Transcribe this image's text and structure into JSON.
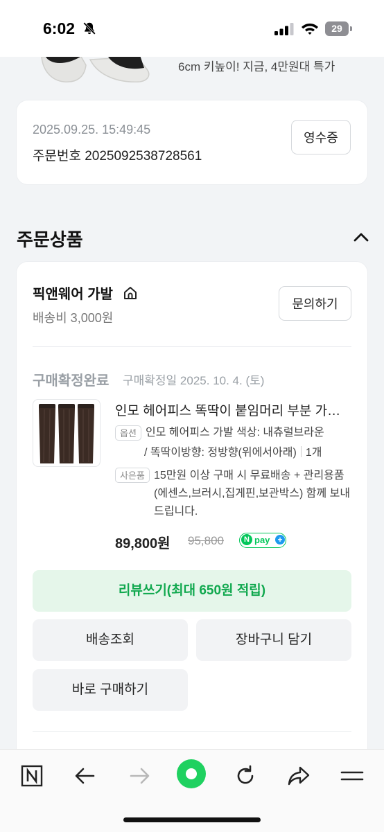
{
  "status_bar": {
    "time": "6:02",
    "battery": "29",
    "icons": [
      "bell-off-icon",
      "signal-icon",
      "wifi-icon",
      "battery-icon"
    ]
  },
  "promo": {
    "text": "6cm 키높이! 지금, 4만원대 특가"
  },
  "order": {
    "date": "2025.09.25. 15:49:45",
    "number_label": "주문번호",
    "number": "2025092538728561",
    "receipt_label": "영수증"
  },
  "section": {
    "title": "주문상품",
    "toggle_icon": "chevron-up-icon"
  },
  "seller": {
    "name": "픽앤웨어 가발",
    "icon": "home-icon",
    "shipping": "배송비 3,000원",
    "inquiry_label": "문의하기"
  },
  "item": {
    "status": "구매확정완료",
    "confirm_date": "구매확정일 2025. 10. 4. (토)",
    "title": "인모 헤어피스 똑딱이 붙임머리 부분 가발 엘사 부분붙임",
    "option_tag": "옵션",
    "option_line1": "인모 헤어피스 가발 색상: 내츄럴브라운",
    "option_line2": "/ 똑딱이방향: 정방향(위에서아래)",
    "quantity": "1개",
    "gift_tag": "사은품",
    "gift_text": "15만원 이상 구매 시 무료배송 + 관리용품(에센스,브러시,집게핀,보관박스) 함께 보내드립니다.",
    "price": "89,800원",
    "original_price": "95,800",
    "npay_n": "N",
    "npay_text": "pay",
    "npay_plus": "+"
  },
  "actions": {
    "review": "리뷰쓰기(최대 650원 적립)",
    "track": "배송조회",
    "cart": "장바구니 담기",
    "buy_again": "바로 구매하기"
  },
  "toolbar": {
    "icons": [
      "naver-home-icon",
      "back-arrow-icon",
      "forward-arrow-icon",
      "green-dot-icon",
      "reload-icon",
      "share-icon",
      "menu-icon"
    ]
  },
  "colors": {
    "accent_green": "#10a84e",
    "review_bg": "#e5f6ea",
    "naver_green": "#03c75a"
  }
}
